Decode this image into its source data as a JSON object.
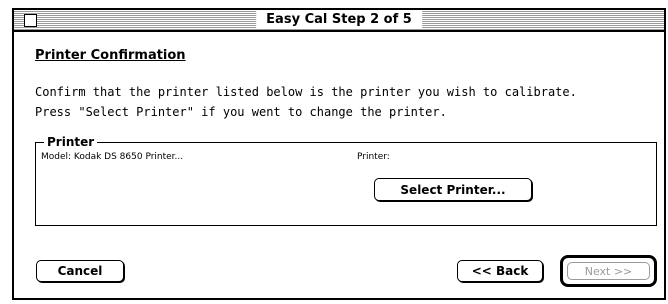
{
  "window": {
    "title": "Easy Cal Step 2 of 5"
  },
  "section": {
    "heading": "Printer Confirmation",
    "instructions_line1": "Confirm that the printer listed below is the printer you wish to calibrate.",
    "instructions_line2": "Press \"Select Printer\" if you went to change the printer."
  },
  "printer_group": {
    "label": "Printer",
    "model_text": "Model: Kodak DS 8650 Printer...",
    "printer_text": "Printer:",
    "select_button_label": "Select Printer..."
  },
  "footer": {
    "cancel_label": "Cancel",
    "back_label": "<< Back",
    "next_label": "Next >>"
  },
  "colors": {
    "disabled_text": "#9a9a9a",
    "title_stripe": "#9a9a9a"
  }
}
